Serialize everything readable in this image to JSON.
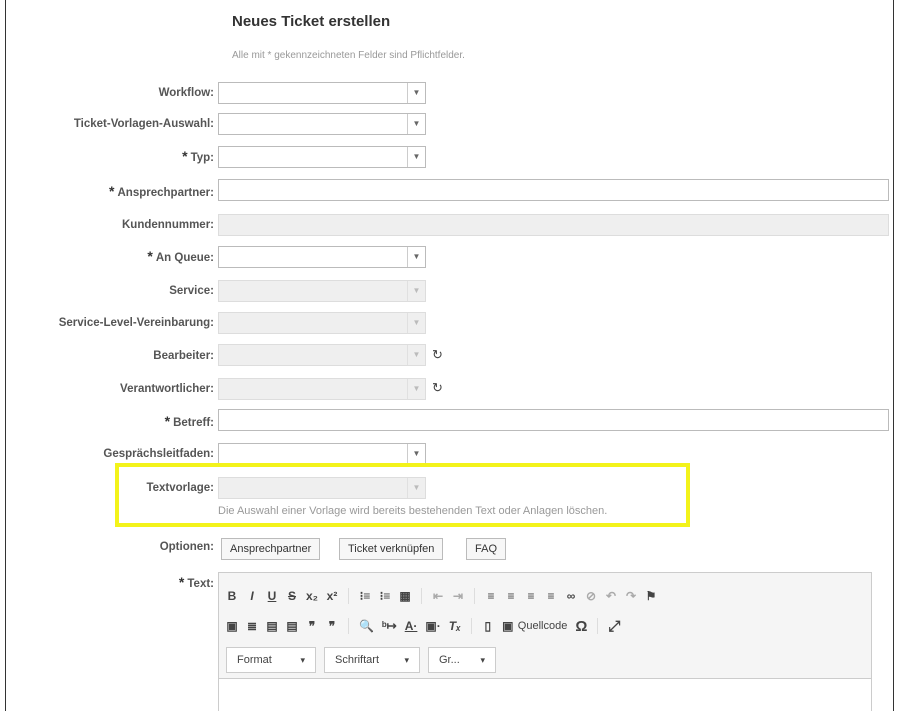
{
  "form": {
    "title": "Neues Ticket erstellen",
    "required_hint": "Alle mit * gekennzeichneten Felder sind Pflichtfelder.",
    "labels": {
      "workflow": "Workflow:",
      "template_select": "Ticket-Vorlagen-Auswahl:",
      "type": "Typ:",
      "contact": "Ansprechpartner:",
      "customer_number": "Kundennummer:",
      "queue": "An Queue:",
      "service": "Service:",
      "sla": "Service-Level-Vereinbarung:",
      "owner": "Bearbeiter:",
      "responsible": "Verantwortlicher:",
      "subject": "Betreff:",
      "guide": "Gesprächsleitfaden:",
      "text_template": "Textvorlage:",
      "options": "Optionen:",
      "text": "Text:"
    },
    "star": "*",
    "text_template_note": "Die Auswahl einer Vorlage wird bereits bestehenden Text oder Anlagen löschen.",
    "option_buttons": [
      "Ansprechpartner",
      "Ticket verknüpfen",
      "FAQ"
    ],
    "dropdown_arrow": "▼",
    "refresh_icon": "↻"
  },
  "editor": {
    "row1": [
      "B",
      "I",
      "U",
      "S",
      "x₂",
      "x²",
      "⁝≡",
      "⁝≡",
      "▦",
      "⇤",
      "⇥",
      "≡",
      "≡",
      "≡",
      "≡",
      "∞",
      "⊘",
      "↶",
      "↷",
      "⚑"
    ],
    "row2": [
      "▣",
      "≣",
      "▤",
      "▤",
      "❞",
      "❞",
      "🔍",
      "ᵇ↦",
      "A·",
      "▣·",
      "Tₓ",
      "▯",
      "▣"
    ],
    "source_label": "Quellcode",
    "omega": "Ω",
    "maximize": "⤢",
    "format_label": "Format",
    "font_label": "Schriftart",
    "size_label": "Gr...",
    "caret": "▾"
  },
  "highlight_color": "#f3f31a"
}
